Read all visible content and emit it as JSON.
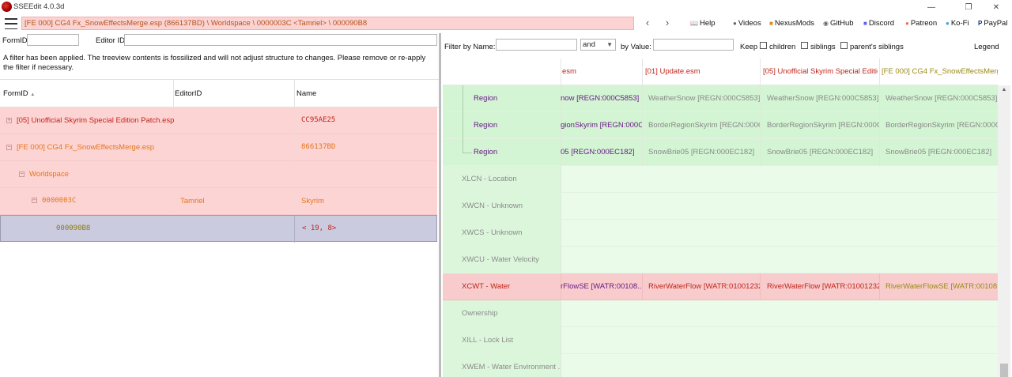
{
  "window": {
    "title": "SSEEdit 4.0.3d",
    "minimize_glyph": "—",
    "restore_glyph": "❐",
    "close_glyph": "✕"
  },
  "toolbar": {
    "path": "[FE 000] CG4 Fx_SnowEffectsMerge.esp (866137BD) \\ Worldspace \\ 0000003C <Tamriel> \\ 000090B8",
    "back_glyph": "‹",
    "forward_glyph": "›",
    "links": [
      {
        "label": "Help",
        "icon": "book-icon",
        "glyph": "📖"
      },
      {
        "label": "Videos",
        "icon": "video-icon",
        "glyph": "●"
      },
      {
        "label": "NexusMods",
        "icon": "nexus-icon",
        "glyph": "■"
      },
      {
        "label": "GitHub",
        "icon": "github-icon",
        "glyph": "◉"
      },
      {
        "label": "Discord",
        "icon": "discord-icon",
        "glyph": "■"
      },
      {
        "label": "Patreon",
        "icon": "patreon-icon",
        "glyph": "●"
      },
      {
        "label": "Ko-Fi",
        "icon": "kofi-icon",
        "glyph": "●"
      },
      {
        "label": "PayPal",
        "icon": "paypal-icon",
        "glyph": "P"
      }
    ]
  },
  "left": {
    "formid_label": "FormID",
    "editorid_label": "Editor ID",
    "formid_value": "",
    "editorid_value": "",
    "notice": "A filter has been applied. The treeview contents is fossilized and will not adjust structure to changes.  Please remove or re-apply the filter if necessary.",
    "columns": [
      "FormID",
      "EditorID",
      "Name"
    ],
    "sort_glyph": "▲",
    "rows": [
      {
        "formid": "[05] Unofficial Skyrim Special Edition Patch.esp",
        "editorid": "",
        "name": "CC95AE25",
        "expander": "+"
      },
      {
        "formid": "[FE 000] CG4 Fx_SnowEffectsMerge.esp",
        "editorid": "",
        "name": "866137BD",
        "expander": "−"
      },
      {
        "formid": "Worldspace",
        "editorid": "",
        "name": "",
        "expander": "−"
      },
      {
        "formid": "0000003C",
        "editorid": "Tamriel",
        "name": "Skyrim",
        "expander": "−"
      },
      {
        "formid": "000090B8",
        "editorid": "",
        "name": "< 19,  8>",
        "expander": ""
      }
    ]
  },
  "right": {
    "filter_by_name_label": "Filter by Name:",
    "filter_by_name_value": "",
    "combine_value": "and",
    "by_value_label": "by Value:",
    "by_value_value": "",
    "keep_label": "Keep",
    "children_label": "children",
    "siblings_label": "siblings",
    "parents_siblings_label": "parent's siblings",
    "legend_label": "Legend",
    "headers": [
      "",
      "esm",
      "[01] Update.esm",
      "[05] Unofficial Skyrim Special Editio...",
      "[FE 000] CG4 Fx_SnowEffectsMerge...."
    ],
    "rows": [
      {
        "label": "Region",
        "cells": [
          "now [REGN:000C5853]",
          "WeatherSnow [REGN:000C5853]",
          "WeatherSnow [REGN:000C5853]",
          "WeatherSnow [REGN:000C5853]"
        ],
        "kind": "sub"
      },
      {
        "label": "Region",
        "cells": [
          "gionSkyrim [REGN:000C...",
          "BorderRegionSkyrim [REGN:000C...",
          "BorderRegionSkyrim [REGN:000C...",
          "BorderRegionSkyrim [REGN:000C..."
        ],
        "kind": "sub"
      },
      {
        "label": "Region",
        "cells": [
          "05 [REGN:000EC182]",
          "SnowBrie05 [REGN:000EC182]",
          "SnowBrie05 [REGN:000EC182]",
          "SnowBrie05 [REGN:000EC182]"
        ],
        "kind": "sub"
      },
      {
        "label": "XLCN - Location",
        "cells": [
          "",
          "",
          "",
          ""
        ],
        "kind": "empty"
      },
      {
        "label": "XWCN - Unknown",
        "cells": [
          "",
          "",
          "",
          ""
        ],
        "kind": "empty"
      },
      {
        "label": "XWCS - Unknown",
        "cells": [
          "",
          "",
          "",
          ""
        ],
        "kind": "empty"
      },
      {
        "label": "XWCU - Water Velocity",
        "cells": [
          "",
          "",
          "",
          ""
        ],
        "kind": "empty"
      },
      {
        "label": "XCWT - Water",
        "cells": [
          "rFlowSE [WATR:00108...",
          "RiverWaterFlow [WATR:01001232]",
          "RiverWaterFlow [WATR:01001232]",
          "RiverWaterFlowSE [WATR:00108..."
        ],
        "kind": "conflict"
      },
      {
        "label": "Ownership",
        "cells": [
          "",
          "",
          "",
          ""
        ],
        "kind": "empty"
      },
      {
        "label": "XILL - Lock List",
        "cells": [
          "",
          "",
          "",
          ""
        ],
        "kind": "empty"
      },
      {
        "label": "XWEM - Water Environment ...",
        "cells": [
          "",
          "",
          "",
          ""
        ],
        "kind": "empty"
      }
    ]
  },
  "colors": {
    "path_bg": "#fbd3d3",
    "conflict_bg": "#f8cccc",
    "green_bg": "#d6f5d6",
    "light_green_bg": "#eafbea",
    "selected_bg": "#cbcbe0"
  }
}
